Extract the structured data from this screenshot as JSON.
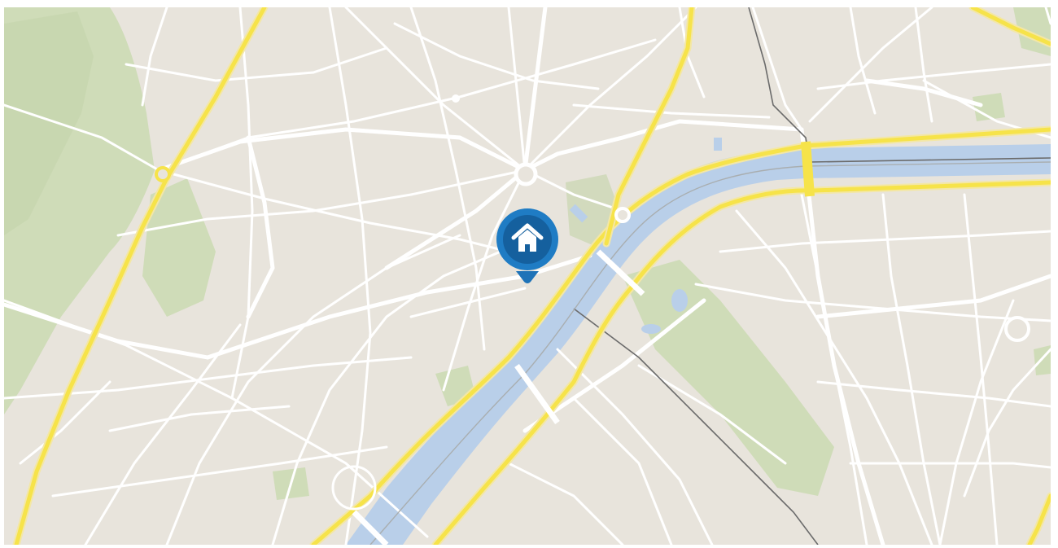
{
  "map": {
    "colors": {
      "land": "#e8e4dc",
      "park": "#cfdcb8",
      "water": "#b9cfe9",
      "major_road": "#f6e34a",
      "minor_road": "#ffffff",
      "boundary": "#6b6b6b"
    }
  },
  "marker": {
    "icon": "home-icon",
    "color": "#1e73b8"
  }
}
